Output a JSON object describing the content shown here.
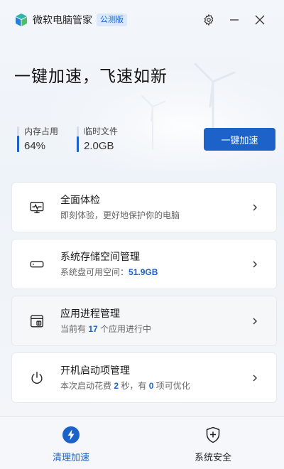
{
  "app": {
    "title": "微软电脑管家",
    "edition": "公测版",
    "icons": {
      "logo": "pc-manager-logo",
      "settings": "gear-icon",
      "minimize": "minimize-icon",
      "close": "close-icon"
    }
  },
  "hero": {
    "title": "一键加速，飞速如新",
    "boost_button": "一键加速"
  },
  "stats": [
    {
      "label": "内存占用",
      "value": "64%",
      "level": 0.64
    },
    {
      "label": "临时文件",
      "value": "2.0GB",
      "level": 0.6
    }
  ],
  "cards": [
    {
      "title": "全面体检",
      "sub": [
        "即刻体验，更好地保护你的电脑"
      ],
      "icon": "health-check-monitor-icon"
    },
    {
      "title": "系统存储空间管理",
      "sub": [
        "系统盘可用空间：",
        "51.9GB"
      ],
      "icon": "storage-drive-icon"
    },
    {
      "title": "应用进程管理",
      "sub": [
        "当前有 ",
        "17",
        " 个应用进行中"
      ],
      "icon": "app-process-icon"
    },
    {
      "title": "开机启动项管理",
      "sub": [
        "本次启动花费 ",
        "2",
        " 秒，有 ",
        "0",
        " 项可优化"
      ],
      "icon": "power-icon"
    }
  ],
  "nav": [
    {
      "label": "清理加速",
      "icon": "lightning-icon",
      "active": true
    },
    {
      "label": "系统安全",
      "icon": "shield-plus-icon",
      "active": false
    }
  ],
  "colors": {
    "accent": "#1d62c9",
    "background": "#f5f7fa",
    "card": "#ffffff"
  }
}
